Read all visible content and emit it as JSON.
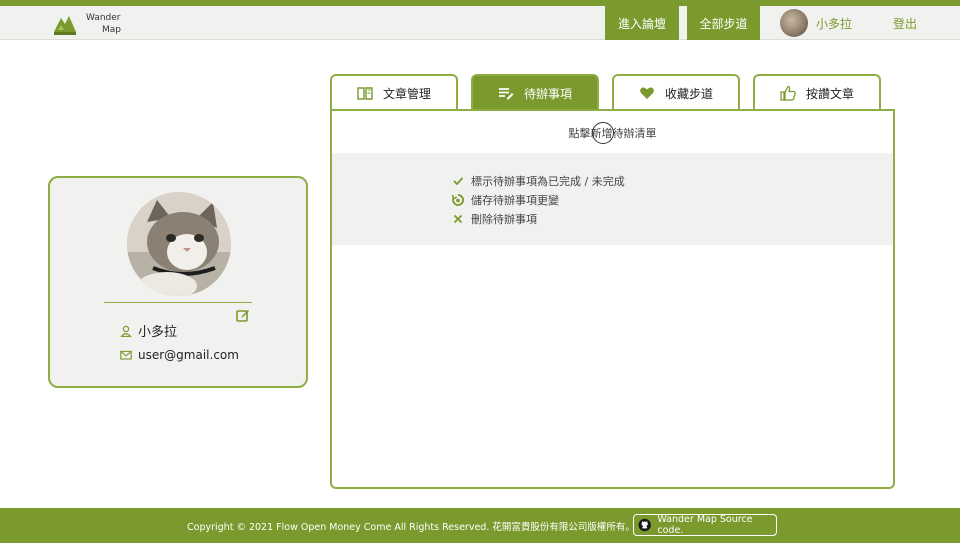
{
  "header": {
    "logo_line1": "Wander",
    "logo_line2": "Map",
    "nav_forum": "進入論壇",
    "nav_trails": "全部步道",
    "username": "小多拉",
    "logout": "登出"
  },
  "profile": {
    "name": "小多拉",
    "email": "user@gmail.com"
  },
  "tabs": [
    {
      "label": "文章管理",
      "icon": "book-icon",
      "active": false
    },
    {
      "label": "待辦事項",
      "icon": "list-edit-icon",
      "active": true
    },
    {
      "label": "收藏步道",
      "icon": "heart-icon",
      "active": false
    },
    {
      "label": "按讚文章",
      "icon": "thumbs-up-icon",
      "active": false
    }
  ],
  "todo": {
    "hint": "點擊新增待辦清單",
    "legend": [
      {
        "icon": "check-icon",
        "text": "標示待辦事項為已完成 / 未完成"
      },
      {
        "icon": "save-icon",
        "text": "儲存待辦事項更變"
      },
      {
        "icon": "close-icon",
        "text": "刪除待辦事項"
      }
    ]
  },
  "footer": {
    "copyright": "Copyright © 2021 Flow Open Money Come All Rights Reserved. 花開富貴股份有限公司版權所有。",
    "source_label": "Wander Map Source code."
  },
  "colors": {
    "accent": "#7a9a2e",
    "border": "#8fad45",
    "panel_bg": "#f1f1ef"
  }
}
